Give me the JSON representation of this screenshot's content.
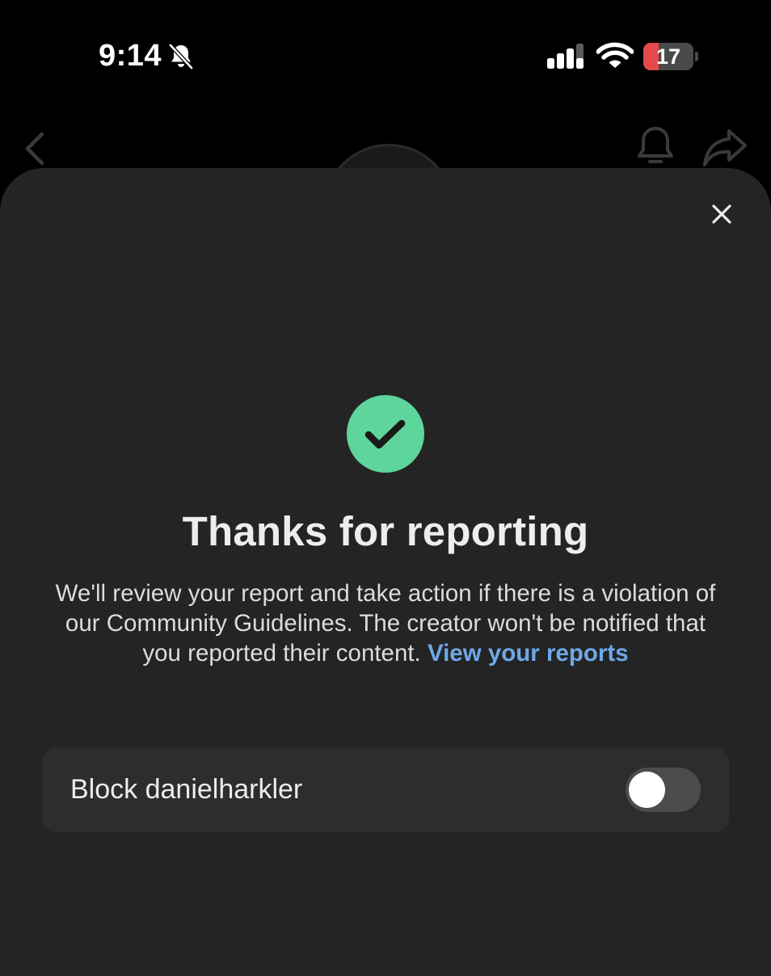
{
  "status_bar": {
    "time": "9:14",
    "battery_level": "17",
    "battery_fraction": 0.17,
    "icons": [
      "bell-muted-icon",
      "signal-icon",
      "wifi-icon",
      "battery-icon"
    ]
  },
  "background_header": {
    "icons": [
      "back-chevron-icon",
      "bell-icon",
      "share-icon"
    ]
  },
  "sheet": {
    "close_icon": "close-icon",
    "success_icon": "checkmark-icon",
    "title": "Thanks for reporting",
    "message_text": "We'll review your report and take action if there is a violation of our Community Guidelines. The creator won't be notified that you reported their content. ",
    "message_link": "View your reports",
    "block_label": "Block danielharkler",
    "block_enabled": false
  },
  "colors": {
    "sheet_background": "#242424",
    "row_background": "#2d2d2d",
    "success_green": "#5ed59a",
    "link_blue": "#6fa8e8",
    "battery_low_red": "#e5484d"
  }
}
